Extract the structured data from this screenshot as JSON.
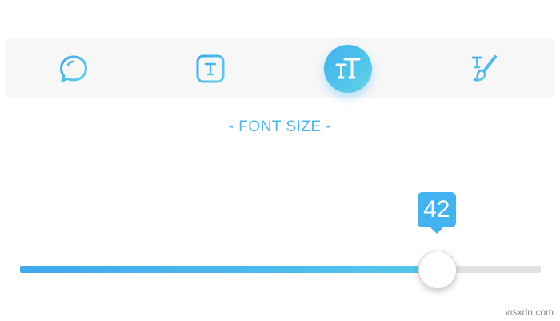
{
  "section": {
    "title": "- FONT SIZE -"
  },
  "slider": {
    "value": "42",
    "fraction": 0.8
  },
  "toolbar": {
    "tools": [
      {
        "icon": "chat-bubble-icon",
        "active": false
      },
      {
        "icon": "text-box-icon",
        "active": false
      },
      {
        "icon": "font-size-icon",
        "active": true
      },
      {
        "icon": "text-style-brush-icon",
        "active": false
      }
    ]
  },
  "colors": {
    "accent": "#42b3ee",
    "track": "#e2e2e4",
    "toolbar_bg": "#f7f7f8"
  },
  "watermark": "wsxdn.com"
}
